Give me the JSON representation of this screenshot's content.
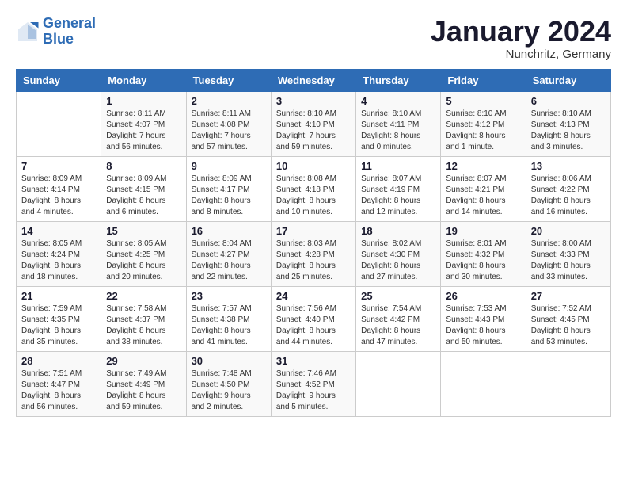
{
  "logo": {
    "line1": "General",
    "line2": "Blue"
  },
  "title": "January 2024",
  "location": "Nunchritz, Germany",
  "days_of_week": [
    "Sunday",
    "Monday",
    "Tuesday",
    "Wednesday",
    "Thursday",
    "Friday",
    "Saturday"
  ],
  "weeks": [
    [
      {
        "day": "",
        "info": ""
      },
      {
        "day": "1",
        "info": "Sunrise: 8:11 AM\nSunset: 4:07 PM\nDaylight: 7 hours\nand 56 minutes."
      },
      {
        "day": "2",
        "info": "Sunrise: 8:11 AM\nSunset: 4:08 PM\nDaylight: 7 hours\nand 57 minutes."
      },
      {
        "day": "3",
        "info": "Sunrise: 8:10 AM\nSunset: 4:10 PM\nDaylight: 7 hours\nand 59 minutes."
      },
      {
        "day": "4",
        "info": "Sunrise: 8:10 AM\nSunset: 4:11 PM\nDaylight: 8 hours\nand 0 minutes."
      },
      {
        "day": "5",
        "info": "Sunrise: 8:10 AM\nSunset: 4:12 PM\nDaylight: 8 hours\nand 1 minute."
      },
      {
        "day": "6",
        "info": "Sunrise: 8:10 AM\nSunset: 4:13 PM\nDaylight: 8 hours\nand 3 minutes."
      }
    ],
    [
      {
        "day": "7",
        "info": "Sunrise: 8:09 AM\nSunset: 4:14 PM\nDaylight: 8 hours\nand 4 minutes."
      },
      {
        "day": "8",
        "info": "Sunrise: 8:09 AM\nSunset: 4:15 PM\nDaylight: 8 hours\nand 6 minutes."
      },
      {
        "day": "9",
        "info": "Sunrise: 8:09 AM\nSunset: 4:17 PM\nDaylight: 8 hours\nand 8 minutes."
      },
      {
        "day": "10",
        "info": "Sunrise: 8:08 AM\nSunset: 4:18 PM\nDaylight: 8 hours\nand 10 minutes."
      },
      {
        "day": "11",
        "info": "Sunrise: 8:07 AM\nSunset: 4:19 PM\nDaylight: 8 hours\nand 12 minutes."
      },
      {
        "day": "12",
        "info": "Sunrise: 8:07 AM\nSunset: 4:21 PM\nDaylight: 8 hours\nand 14 minutes."
      },
      {
        "day": "13",
        "info": "Sunrise: 8:06 AM\nSunset: 4:22 PM\nDaylight: 8 hours\nand 16 minutes."
      }
    ],
    [
      {
        "day": "14",
        "info": "Sunrise: 8:05 AM\nSunset: 4:24 PM\nDaylight: 8 hours\nand 18 minutes."
      },
      {
        "day": "15",
        "info": "Sunrise: 8:05 AM\nSunset: 4:25 PM\nDaylight: 8 hours\nand 20 minutes."
      },
      {
        "day": "16",
        "info": "Sunrise: 8:04 AM\nSunset: 4:27 PM\nDaylight: 8 hours\nand 22 minutes."
      },
      {
        "day": "17",
        "info": "Sunrise: 8:03 AM\nSunset: 4:28 PM\nDaylight: 8 hours\nand 25 minutes."
      },
      {
        "day": "18",
        "info": "Sunrise: 8:02 AM\nSunset: 4:30 PM\nDaylight: 8 hours\nand 27 minutes."
      },
      {
        "day": "19",
        "info": "Sunrise: 8:01 AM\nSunset: 4:32 PM\nDaylight: 8 hours\nand 30 minutes."
      },
      {
        "day": "20",
        "info": "Sunrise: 8:00 AM\nSunset: 4:33 PM\nDaylight: 8 hours\nand 33 minutes."
      }
    ],
    [
      {
        "day": "21",
        "info": "Sunrise: 7:59 AM\nSunset: 4:35 PM\nDaylight: 8 hours\nand 35 minutes."
      },
      {
        "day": "22",
        "info": "Sunrise: 7:58 AM\nSunset: 4:37 PM\nDaylight: 8 hours\nand 38 minutes."
      },
      {
        "day": "23",
        "info": "Sunrise: 7:57 AM\nSunset: 4:38 PM\nDaylight: 8 hours\nand 41 minutes."
      },
      {
        "day": "24",
        "info": "Sunrise: 7:56 AM\nSunset: 4:40 PM\nDaylight: 8 hours\nand 44 minutes."
      },
      {
        "day": "25",
        "info": "Sunrise: 7:54 AM\nSunset: 4:42 PM\nDaylight: 8 hours\nand 47 minutes."
      },
      {
        "day": "26",
        "info": "Sunrise: 7:53 AM\nSunset: 4:43 PM\nDaylight: 8 hours\nand 50 minutes."
      },
      {
        "day": "27",
        "info": "Sunrise: 7:52 AM\nSunset: 4:45 PM\nDaylight: 8 hours\nand 53 minutes."
      }
    ],
    [
      {
        "day": "28",
        "info": "Sunrise: 7:51 AM\nSunset: 4:47 PM\nDaylight: 8 hours\nand 56 minutes."
      },
      {
        "day": "29",
        "info": "Sunrise: 7:49 AM\nSunset: 4:49 PM\nDaylight: 8 hours\nand 59 minutes."
      },
      {
        "day": "30",
        "info": "Sunrise: 7:48 AM\nSunset: 4:50 PM\nDaylight: 9 hours\nand 2 minutes."
      },
      {
        "day": "31",
        "info": "Sunrise: 7:46 AM\nSunset: 4:52 PM\nDaylight: 9 hours\nand 5 minutes."
      },
      {
        "day": "",
        "info": ""
      },
      {
        "day": "",
        "info": ""
      },
      {
        "day": "",
        "info": ""
      }
    ]
  ]
}
